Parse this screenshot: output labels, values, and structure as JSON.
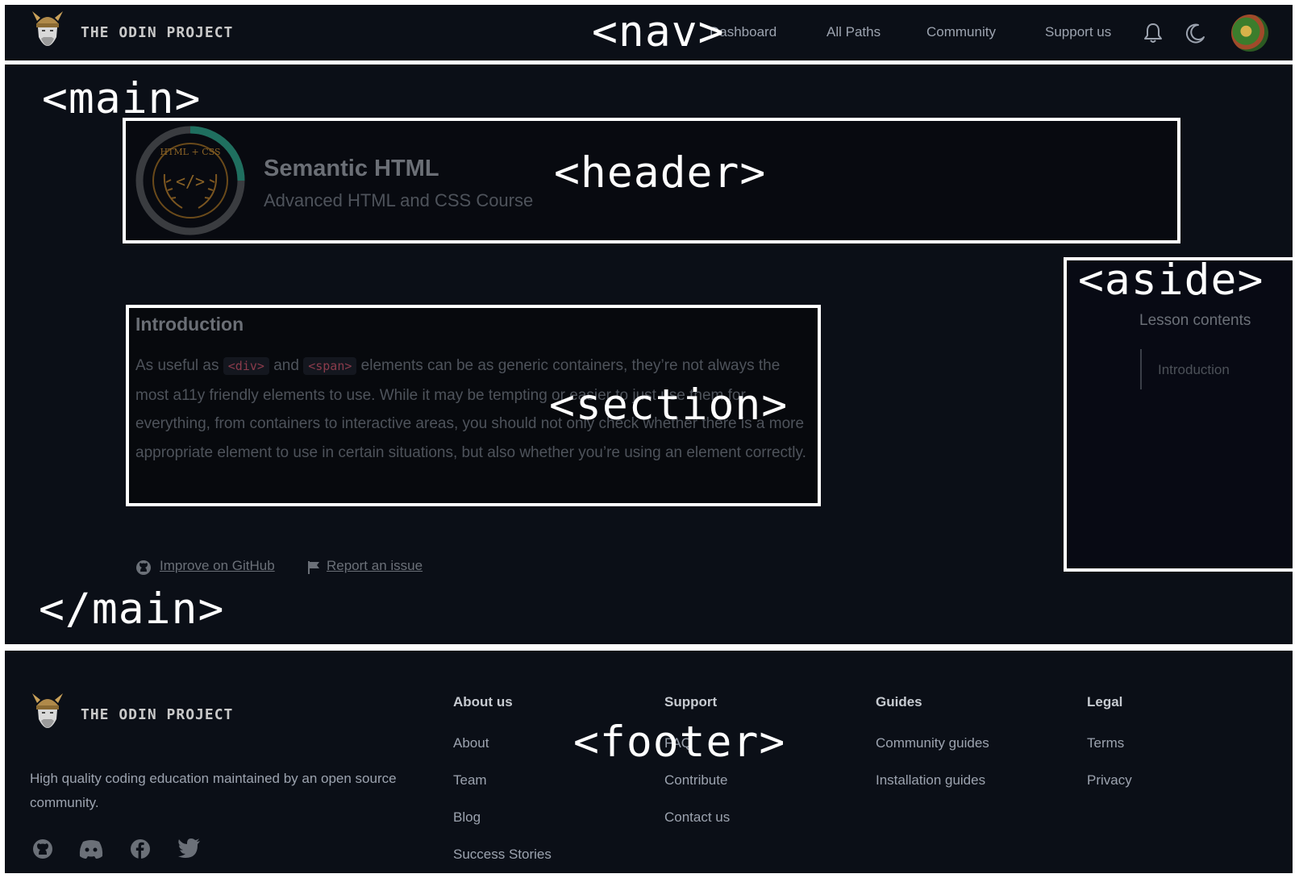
{
  "colors": {
    "page_bg": "#0b0f17",
    "outline": "#ffffff",
    "code_text": "#8a3b4b",
    "ring_progress": "#1f6f5f"
  },
  "overlay_tags": {
    "nav": "<nav>",
    "main_open": "<main>",
    "header": "<header>",
    "aside": "<aside>",
    "section": "<section>",
    "main_close": "</main>",
    "footer": "<footer>"
  },
  "nav": {
    "brand": "THE ODIN PROJECT",
    "links": [
      "Dashboard",
      "All Paths",
      "Community",
      "Support us"
    ],
    "icons": [
      "bell-icon",
      "moon-icon"
    ]
  },
  "header": {
    "badge_text": "HTML + CSS",
    "badge_symbol": "</>",
    "lesson_title": "Semantic HTML",
    "course_title": "Advanced HTML and CSS Course"
  },
  "section": {
    "heading": "Introduction",
    "p_1": "As useful as ",
    "code_1": "<div>",
    "p_2": " and ",
    "code_2": "<span>",
    "p_3": " elements can be as generic containers, they’re not always the most a11y friendly elements to use. While it may be tempting or easier to just use them for everything, from containers to interactive areas, you should not only check whether there is a more appropriate element to use in certain situations, but also whether you’re using an element correctly."
  },
  "main_links": {
    "github": "Improve on GitHub",
    "report": "Report an issue"
  },
  "aside": {
    "heading": "Lesson contents",
    "items": [
      "Introduction"
    ]
  },
  "footer": {
    "brand": "THE ODIN PROJECT",
    "tagline": "High quality coding education maintained by an open source community.",
    "columns": [
      {
        "title": "About us",
        "links": [
          "About",
          "Team",
          "Blog",
          "Success Stories"
        ]
      },
      {
        "title": "Support",
        "links": [
          "FAQ",
          "Contribute",
          "Contact us"
        ]
      },
      {
        "title": "Guides",
        "links": [
          "Community guides",
          "Installation guides"
        ]
      },
      {
        "title": "Legal",
        "links": [
          "Terms",
          "Privacy"
        ]
      }
    ],
    "social_icons": [
      "github-icon",
      "discord-icon",
      "facebook-icon",
      "twitter-icon"
    ]
  }
}
